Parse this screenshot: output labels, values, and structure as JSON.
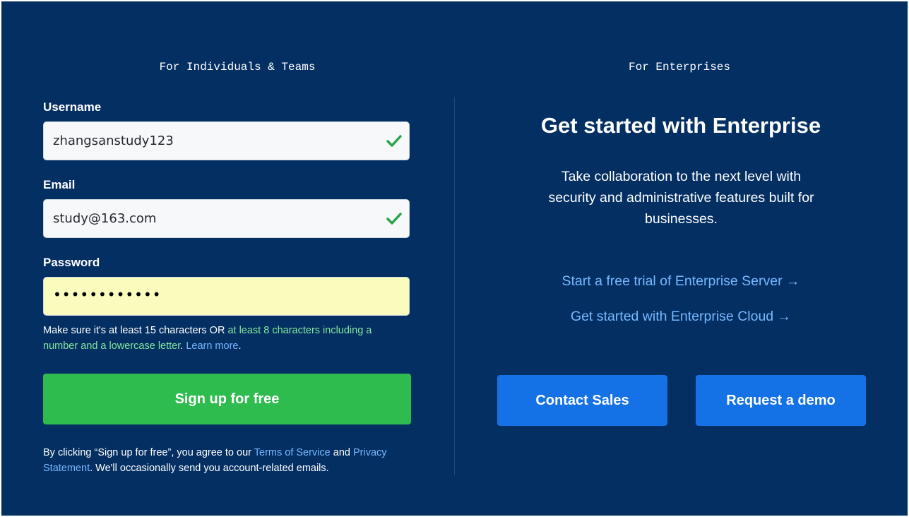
{
  "individuals": {
    "heading": "For Individuals & Teams",
    "username": {
      "label": "Username",
      "value": "zhangsanstudy123",
      "valid": true
    },
    "email": {
      "label": "Email",
      "value": "study@163.com",
      "valid": true
    },
    "password": {
      "label": "Password",
      "masked_value": "••••••••••••"
    },
    "hint": {
      "prefix": "Make sure it's at least 15 characters OR ",
      "requirement": "at least 8 characters including a number and a lowercase letter",
      "sep": ". ",
      "learn_more": "Learn more",
      "suffix": "."
    },
    "signup_button": "Sign up for free",
    "terms": {
      "prefix": "By clicking “Sign up for free”, you agree to our ",
      "tos": "Terms of Service",
      "and": " and ",
      "privacy": "Privacy Statement",
      "suffix": ". We'll occasionally send you account-related emails."
    }
  },
  "enterprise": {
    "heading": "For Enterprises",
    "title": "Get started with Enterprise",
    "description": "Take collaboration to the next level with security and administrative features built for businesses.",
    "links": [
      "Start a free trial of Enterprise Server →",
      "Get started with Enterprise Cloud →"
    ],
    "contact_sales": "Contact Sales",
    "request_demo": "Request a demo"
  },
  "colors": {
    "background": "#032f62",
    "signup_green": "#2ebc4f",
    "enterprise_blue": "#1571e6",
    "link_blue": "#79b8ff",
    "hint_green": "#85e89d",
    "check_green": "#2da44e",
    "password_fill": "#f9fcbc"
  },
  "icons": {
    "valid": "check-icon"
  }
}
